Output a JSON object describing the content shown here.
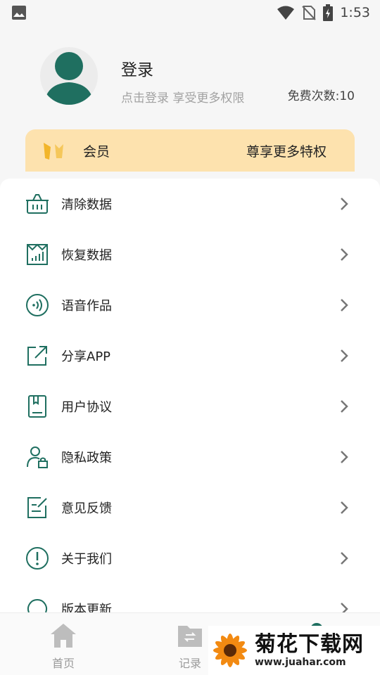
{
  "status_bar": {
    "time": "1:53",
    "icons": [
      "image-icon",
      "wifi-icon",
      "no-sim-icon",
      "battery-charging-icon"
    ]
  },
  "profile": {
    "title": "登录",
    "subtitle": "点击登录 享受更多权限",
    "free_count": "免费次数:10"
  },
  "vip": {
    "label": "会员",
    "right_text": "尊享更多特权"
  },
  "menu": {
    "items": [
      {
        "label": "清除数据",
        "icon": "basket-icon"
      },
      {
        "label": "恢复数据",
        "icon": "restore-chart-icon"
      },
      {
        "label": "语音作品",
        "icon": "audio-icon"
      },
      {
        "label": "分享APP",
        "icon": "share-icon"
      },
      {
        "label": "用户协议",
        "icon": "book-icon"
      },
      {
        "label": "隐私政策",
        "icon": "user-lock-icon"
      },
      {
        "label": "意见反馈",
        "icon": "feedback-icon"
      },
      {
        "label": "关于我们",
        "icon": "info-icon"
      },
      {
        "label": "版本更新",
        "icon": "update-icon"
      }
    ]
  },
  "bottom_nav": {
    "items": [
      {
        "label": "首页",
        "icon": "home-icon"
      },
      {
        "label": "记录",
        "icon": "record-folder-icon"
      }
    ]
  },
  "watermark": {
    "big": "菊花下载网",
    "small": "www.juahar.com"
  },
  "colors": {
    "accent": "#1f6f60",
    "vip_bg": "#fde2ae",
    "background": "#f6f6f6"
  }
}
